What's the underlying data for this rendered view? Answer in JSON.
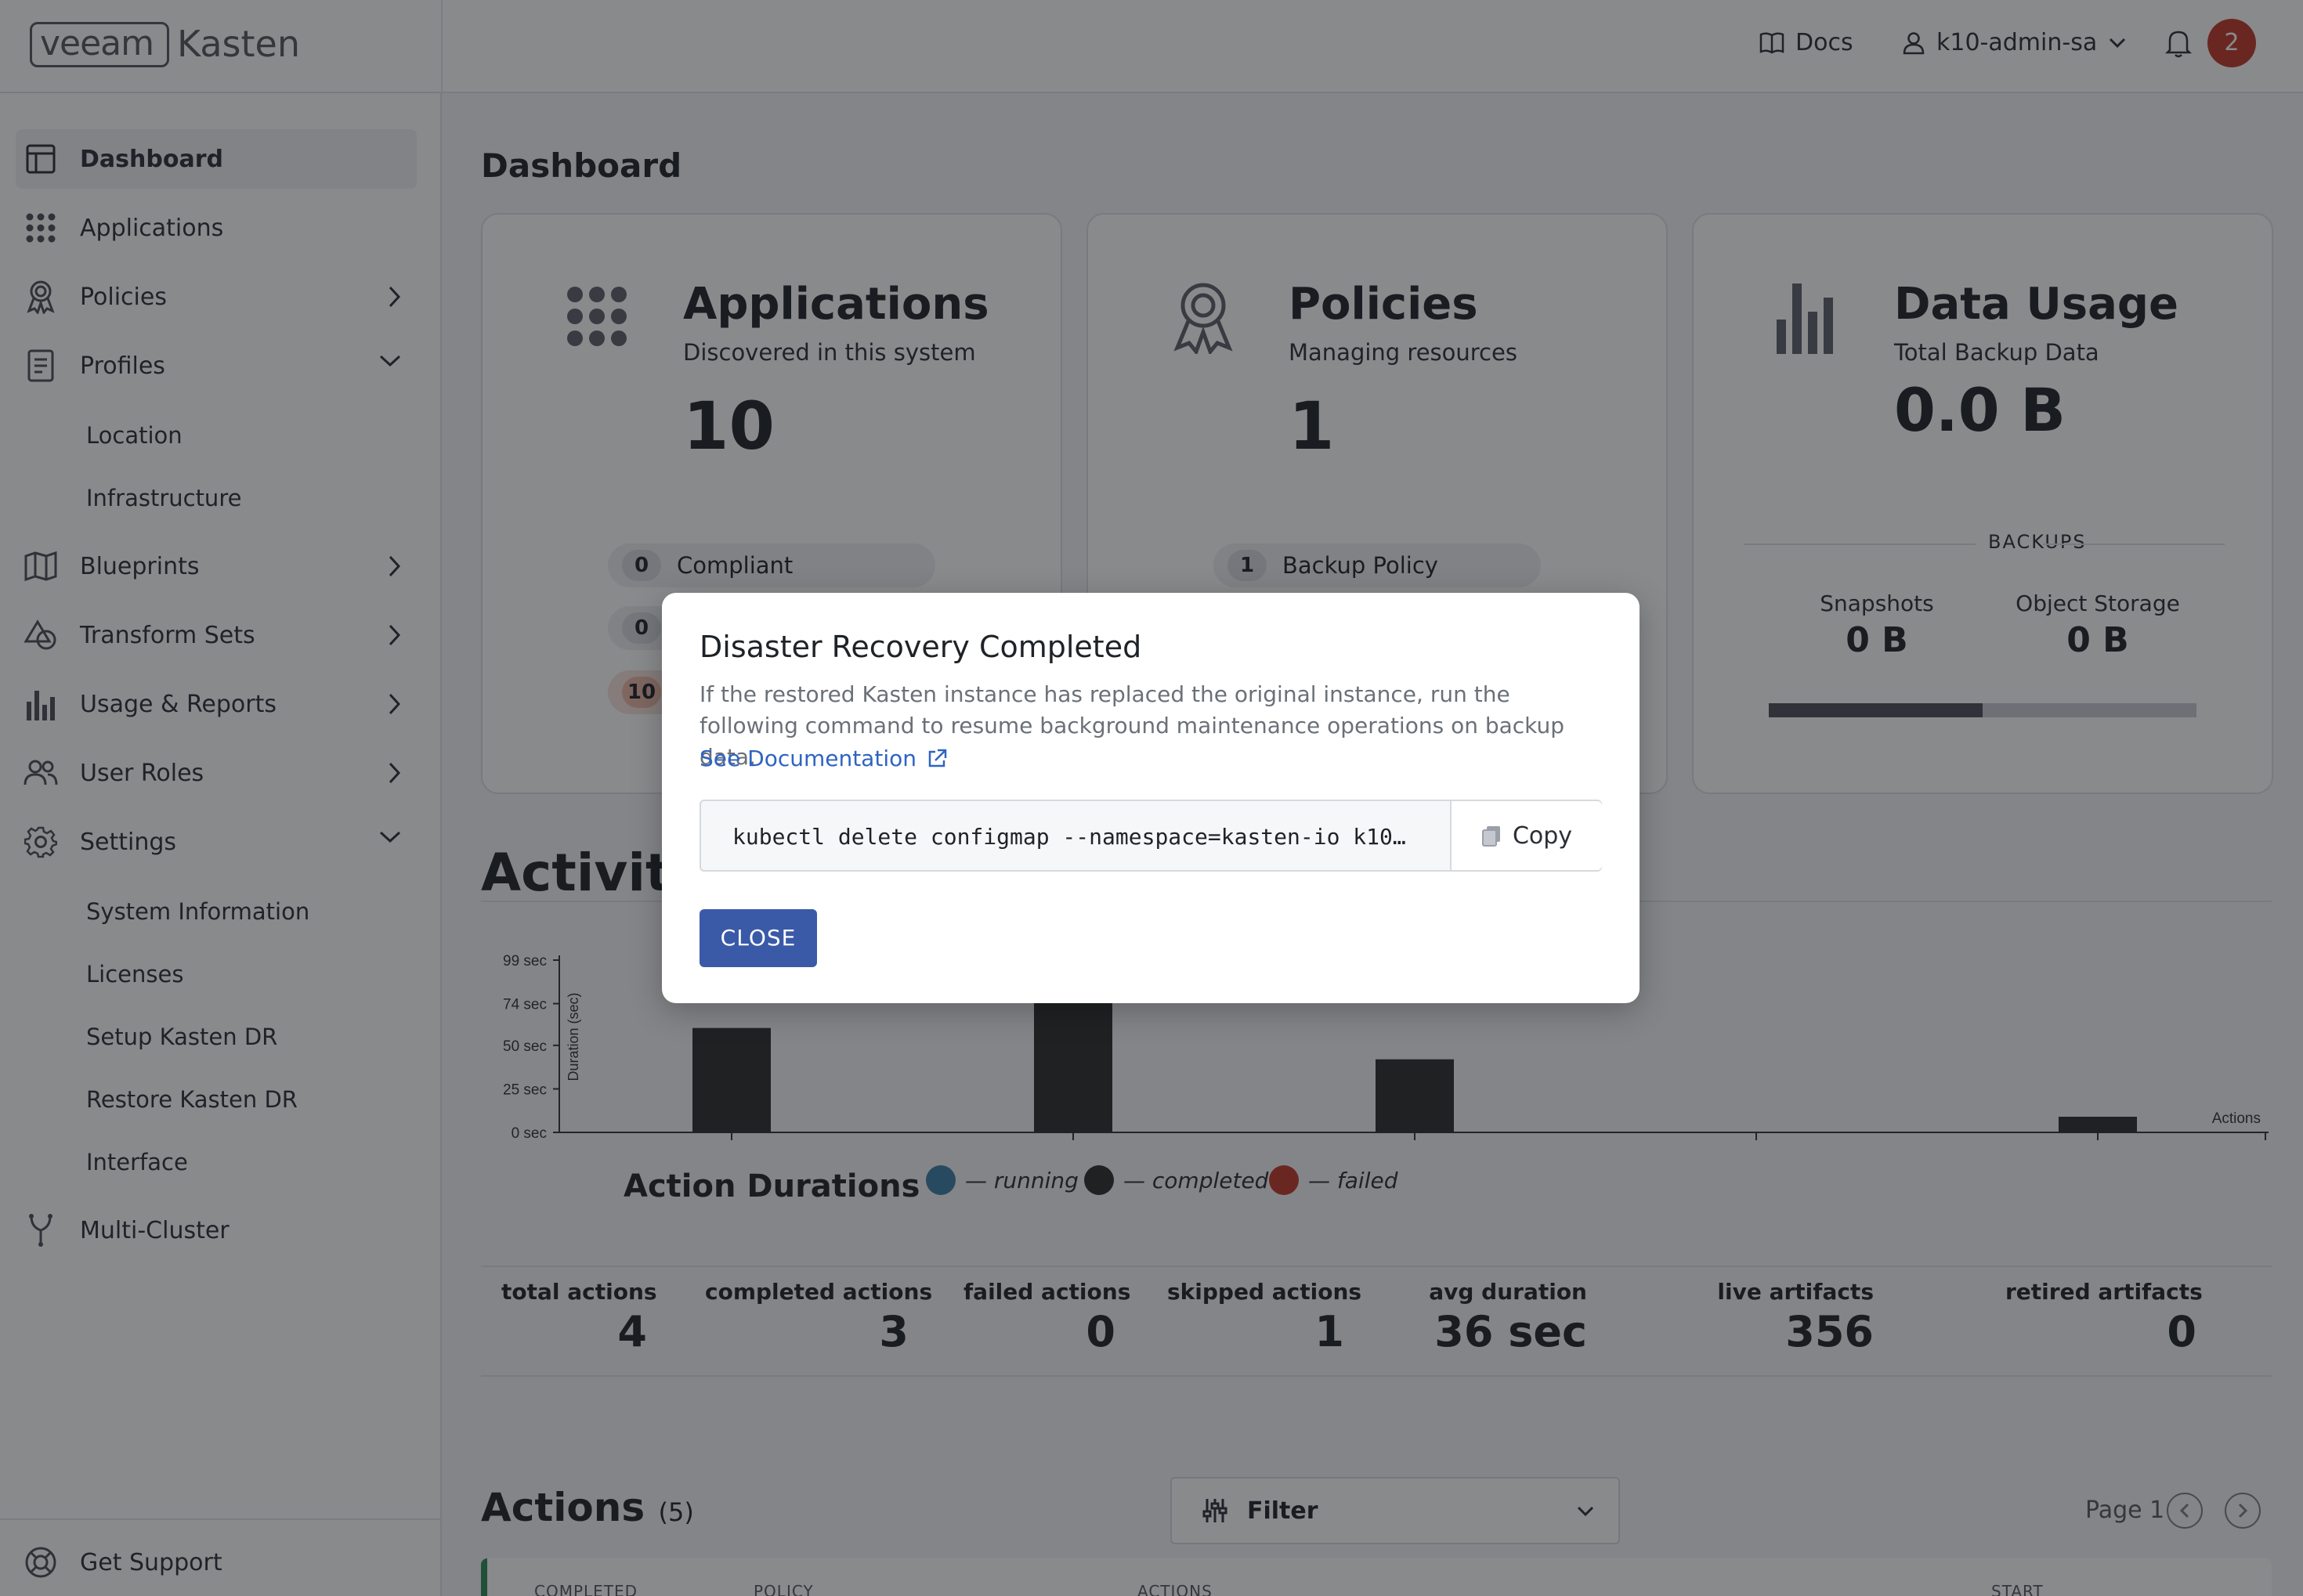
{
  "app": {
    "brand_left": "veeam",
    "brand_right": "Kasten"
  },
  "topbar": {
    "docs_label": "Docs",
    "user_label": "k10-admin-sa",
    "notifications_count": "2"
  },
  "sidebar": {
    "items": [
      {
        "label": "Dashboard",
        "icon": "dashboard-icon"
      },
      {
        "label": "Applications",
        "icon": "grid-dots-icon"
      },
      {
        "label": "Policies",
        "icon": "ribbon-icon"
      },
      {
        "label": "Profiles",
        "icon": "clipboard-icon"
      },
      {
        "label": "Blueprints",
        "icon": "map-icon"
      },
      {
        "label": "Transform Sets",
        "icon": "shapes-icon"
      },
      {
        "label": "Usage & Reports",
        "icon": "bar-chart-icon"
      },
      {
        "label": "User Roles",
        "icon": "users-icon"
      },
      {
        "label": "Settings",
        "icon": "gear-icon"
      },
      {
        "label": "Multi-Cluster",
        "icon": "branch-icon"
      }
    ],
    "profiles_sub": [
      "Location",
      "Infrastructure"
    ],
    "settings_sub": [
      "System Information",
      "Licenses",
      "Setup Kasten DR",
      "Restore Kasten DR",
      "Interface"
    ],
    "support_label": "Get Support"
  },
  "main": {
    "title": "Dashboard",
    "cards": {
      "applications": {
        "title": "Applications",
        "subtitle": "Discovered in this system",
        "value": "10",
        "pills": [
          {
            "count": "0",
            "label": "Compliant"
          },
          {
            "count": "0",
            "label": ""
          },
          {
            "count": "10",
            "label": ""
          }
        ]
      },
      "policies": {
        "title": "Policies",
        "subtitle": "Managing resources",
        "value": "1",
        "pills": [
          {
            "count": "1",
            "label": "Backup Policy"
          }
        ]
      },
      "data_usage": {
        "title": "Data Usage",
        "subtitle": "Total Backup Data",
        "value": "0.0 B",
        "section_label": "BACKUPS",
        "snapshots_label": "Snapshots",
        "snapshots_value": "0 B",
        "object_storage_label": "Object Storage",
        "object_storage_value": "0 B"
      }
    },
    "activity": {
      "title": "Activity",
      "chart_title": "Action Durations",
      "legend": [
        {
          "label": "— running",
          "color": "#3d7ea6"
        },
        {
          "label": "— completed",
          "color": "#2d2d2d"
        },
        {
          "label": "— failed",
          "color": "#c0392b"
        }
      ]
    },
    "stats": [
      {
        "label": "total actions",
        "value": "4"
      },
      {
        "label": "completed actions",
        "value": "3"
      },
      {
        "label": "failed actions",
        "value": "0"
      },
      {
        "label": "skipped actions",
        "value": "1"
      },
      {
        "label": "avg duration",
        "value": "36 sec"
      },
      {
        "label": "live artifacts",
        "value": "356"
      },
      {
        "label": "retired artifacts",
        "value": "0"
      }
    ],
    "actions": {
      "title": "Actions",
      "count": "(5)",
      "filter_label": "Filter",
      "page_label": "Page 1",
      "columns": [
        "COMPLETED",
        "POLICY",
        "ACTIONS",
        "START"
      ]
    }
  },
  "chart_data": {
    "type": "bar",
    "title": "Action Durations",
    "ylabel": "Duration (sec)",
    "xlabel": "Actions",
    "ylim": [
      0,
      99
    ],
    "yticks": [
      "0 sec",
      "25 sec",
      "50 sec",
      "74 sec",
      "99 sec"
    ],
    "ytick_values": [
      0,
      25,
      50,
      74,
      99
    ],
    "series": [
      {
        "name": "completed",
        "values": [
          60,
          80,
          42,
          0,
          9
        ]
      }
    ]
  },
  "modal": {
    "title": "Disaster Recovery Completed",
    "body": "If the restored Kasten instance has replaced the original instance, run the following command to resume background maintenance operations on backup data.",
    "link_label": "See Documentation",
    "command": "kubectl delete configmap --namespace=kasten-io k10…",
    "copy_label": "Copy",
    "close_label": "CLOSE"
  }
}
